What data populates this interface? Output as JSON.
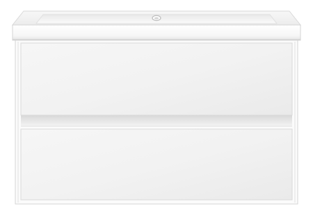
{
  "product": {
    "body_color": "#ffffff",
    "shade_light": "#f4f4f4",
    "shade_mid": "#e6e6e6",
    "shade_dark": "#cfcfcf",
    "outline": "#d2d2d2"
  },
  "scene": {
    "background": "#ffffff"
  }
}
